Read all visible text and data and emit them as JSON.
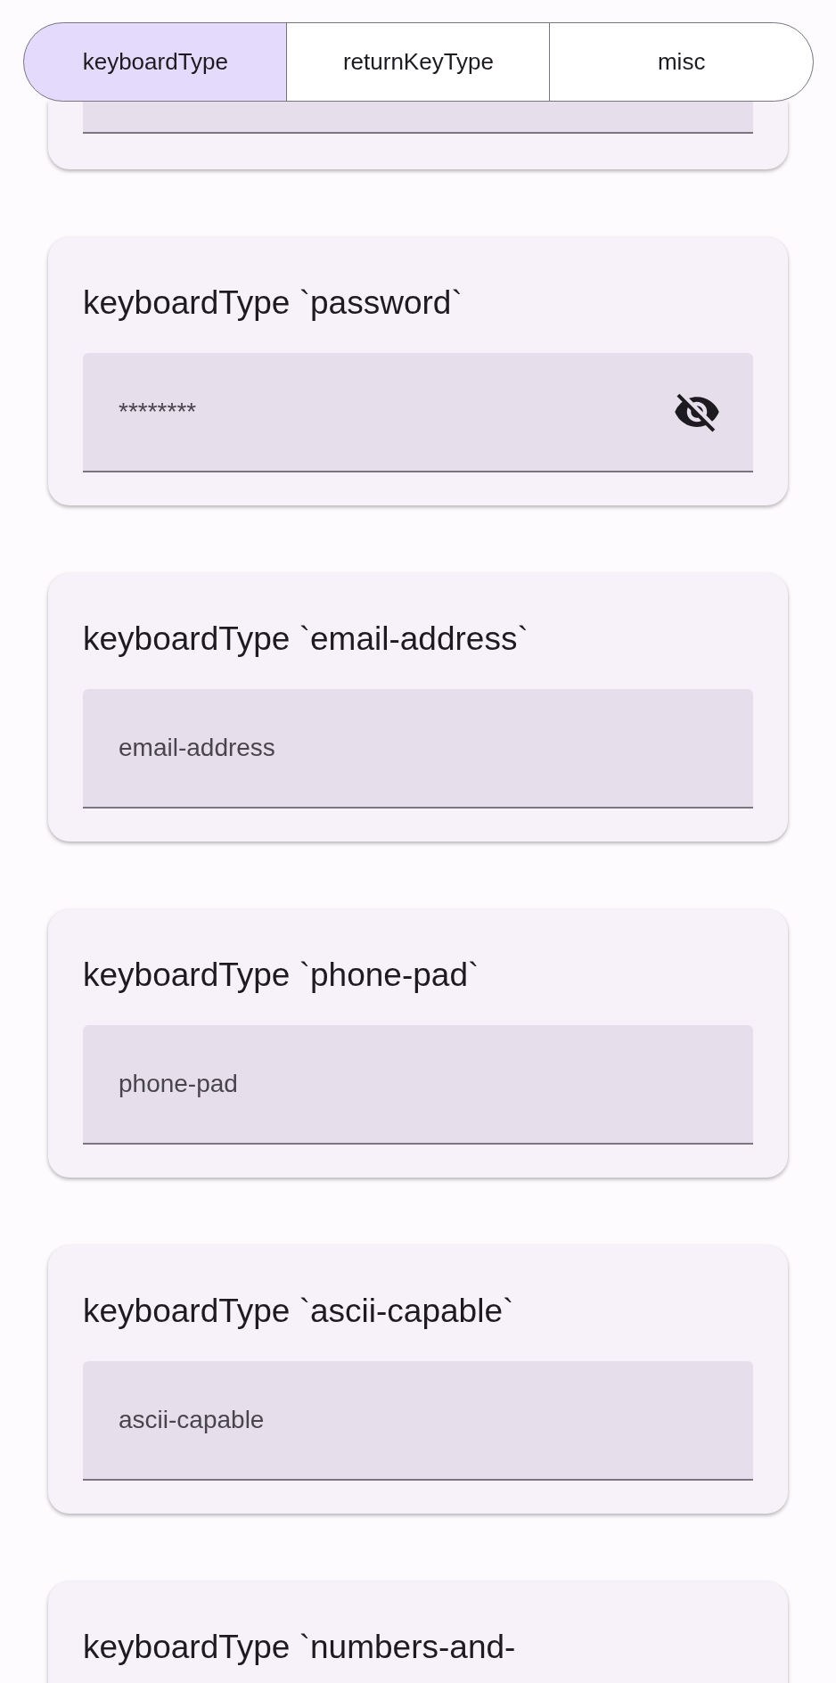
{
  "tabs": [
    {
      "label": "keyboardType",
      "selected": true
    },
    {
      "label": "returnKeyType",
      "selected": false
    },
    {
      "label": "misc",
      "selected": false
    }
  ],
  "cards": [
    {
      "title": "keyboardType `password`",
      "kind": "password",
      "value": "********"
    },
    {
      "title": "keyboardType `email-address`",
      "kind": "text",
      "value": "email-address"
    },
    {
      "title": "keyboardType `phone-pad`",
      "kind": "text",
      "value": "phone-pad"
    },
    {
      "title": "keyboardType `ascii-capable`",
      "kind": "text",
      "value": "ascii-capable"
    },
    {
      "title": "keyboardType `numbers-and-",
      "kind": "cut"
    }
  ]
}
